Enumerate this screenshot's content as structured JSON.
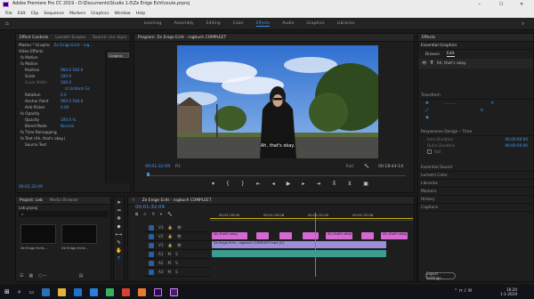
{
  "window": {
    "title": "Adobe Premiere Pro CC 2019 - D:\\Documents\\Studio 1.0\\Ze Enige Echt\\route.prproj",
    "min": "–",
    "max": "☐",
    "close": "✕"
  },
  "menu": [
    "File",
    "Edit",
    "Clip",
    "Sequence",
    "Markers",
    "Graphics",
    "Window",
    "Help"
  ],
  "workspaces": [
    {
      "label": "Learning"
    },
    {
      "label": "Assembly"
    },
    {
      "label": "Editing"
    },
    {
      "label": "Color"
    },
    {
      "label": "Effects",
      "active": true
    },
    {
      "label": "Audio"
    },
    {
      "label": "Graphics"
    },
    {
      "label": "Libraries"
    }
  ],
  "effect_controls": {
    "tabs": [
      "Effect Controls",
      "Lumetri Scopes",
      "Source: (no clips)"
    ],
    "header_left": "Master * Graphic",
    "header_right": "Ze Enige Echt - rog...",
    "header_clip": "Graphic",
    "section": "Video Effects",
    "rows": [
      {
        "label": "fx  Motion",
        "vals": "",
        "ind": 1
      },
      {
        "label": "fx  Motion",
        "vals": "",
        "ind": 1
      },
      {
        "label": "Position",
        "vals": "960.0    540.0",
        "ind": 2
      },
      {
        "label": "Scale",
        "vals": "100.0",
        "ind": 2
      },
      {
        "label": "Scale Width",
        "vals": "100.0",
        "ind": 2,
        "dim": true
      },
      {
        "label": "",
        "vals": "☑ Uniform Sc",
        "ind": 3
      },
      {
        "label": "Rotation",
        "vals": "0.0",
        "ind": 2
      },
      {
        "label": "Anchor Point",
        "vals": "960.0    540.0",
        "ind": 2
      },
      {
        "label": "Anti-flicker",
        "vals": "0.00",
        "ind": 2
      },
      {
        "label": "fx  Opacity",
        "vals": "",
        "ind": 1
      },
      {
        "label": "Opacity",
        "vals": "100.0 %",
        "ind": 2
      },
      {
        "label": "Blend Mode",
        "vals": "Normal",
        "ind": 2
      },
      {
        "label": "fx  Time Remapping",
        "vals": "",
        "ind": 1
      },
      {
        "label": "fx  Text (Ah, that's okay.)",
        "vals": "",
        "ind": 1
      },
      {
        "label": "Source Text",
        "vals": "",
        "ind": 2
      }
    ],
    "timecode": "00:01:32:09"
  },
  "program_monitor": {
    "tab": "Program: Ze Enige Echt - rogbuch COMPLEET",
    "timecode": "00:01:32:09",
    "fit": "Fit",
    "quality": "Full",
    "duration": "00:18:44:14",
    "caption": "Ah, that's okay."
  },
  "project": {
    "tabs": [
      "Project: Leb",
      "Media Browser"
    ],
    "file": "Leb.prproj",
    "items": [
      {
        "label": "Ze Enige Echt...",
        "sub": "Ze Enige Echt"
      },
      {
        "label": "Ze Enige Echt...",
        "sub": "Ze Enige Echt"
      }
    ]
  },
  "timeline": {
    "tab": "Ze Enige Echt - rogbuch COMPLEET",
    "timecode": "00:01:32:09",
    "ruler": [
      "00:01:30:00",
      "00:01:30:08",
      "00:01:31:00",
      "00:01:32:08"
    ],
    "tracks": [
      "V3",
      "V2",
      "V1",
      "A1",
      "A2",
      "A3"
    ],
    "clips_text": [
      "Ah, that's okay.",
      "Ah, that's okay.",
      "Ah, that's okay."
    ],
    "video_clip": "Ze Enige Echt - rogbuch COMPLEET.mp4 [V]"
  },
  "effects_panel": {
    "title": "Effects",
    "essential": "Essential Graphics",
    "tabs": [
      "Browse",
      "Edit"
    ],
    "layer": "Ah, that's okay.",
    "sections": [
      "Transform",
      "Responsive Design – Time",
      "Essential Sound",
      "Lumetri Color",
      "Libraries",
      "Markers",
      "History",
      "Captions"
    ],
    "time_labels": [
      "Intro Duration",
      "Outro Duration"
    ],
    "time_values": [
      "00:00:00:00",
      "00:00:00:00"
    ],
    "roll": "Roll",
    "btn": "Export Settings..."
  },
  "taskbar": {
    "time": "16:20",
    "date": "1-1-2019"
  }
}
